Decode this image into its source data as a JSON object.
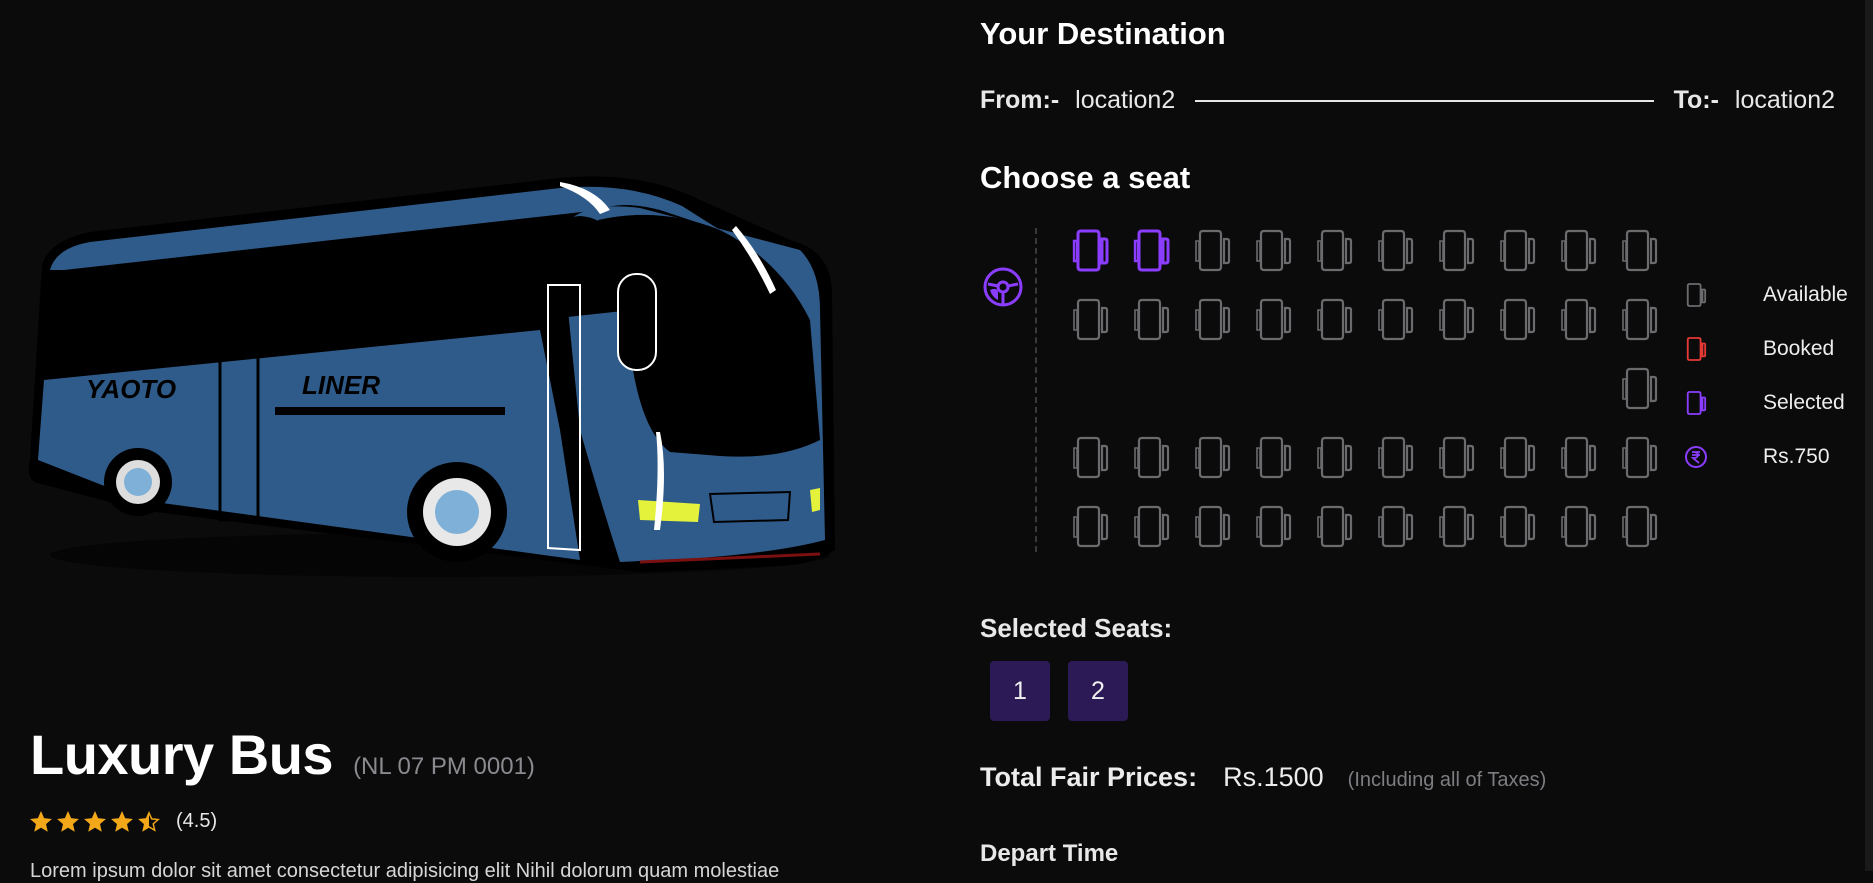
{
  "bus": {
    "name": "Luxury Bus",
    "plate": "(NL 07 PM 0001)",
    "rating_text": "(4.5)",
    "rating_value": 4.5,
    "rating_max": 5,
    "body_text_left": "YAOTO",
    "body_text_right": "LINER",
    "description_partial": "Lorem ipsum dolor sit amet consectetur adipisicing elit Nihil dolorum quam molestiae"
  },
  "destination": {
    "heading": "Your Destination",
    "from_label": "From:-",
    "from_value": "location2",
    "to_label": "To:-",
    "to_value": "location2"
  },
  "seating": {
    "heading": "Choose a seat",
    "driver_icon": "steering-wheel-icon",
    "seats": [
      {
        "id": 1,
        "status": "selected"
      },
      {
        "id": 2,
        "status": "selected"
      },
      {
        "id": 3,
        "status": "available"
      },
      {
        "id": 4,
        "status": "available"
      },
      {
        "id": 5,
        "status": "available"
      },
      {
        "id": 6,
        "status": "available"
      },
      {
        "id": 7,
        "status": "available"
      },
      {
        "id": 8,
        "status": "available"
      },
      {
        "id": 9,
        "status": "available"
      },
      {
        "id": 10,
        "status": "available"
      },
      {
        "id": 11,
        "status": "available"
      },
      {
        "id": 12,
        "status": "available"
      },
      {
        "id": 13,
        "status": "available"
      },
      {
        "id": 14,
        "status": "available"
      },
      {
        "id": 15,
        "status": "available"
      },
      {
        "id": 16,
        "status": "available"
      },
      {
        "id": 17,
        "status": "available"
      },
      {
        "id": 18,
        "status": "available"
      },
      {
        "id": 19,
        "status": "available"
      },
      {
        "id": 20,
        "status": "available"
      },
      {
        "id": 21,
        "status": "available"
      },
      {
        "id": 22,
        "status": "available"
      },
      {
        "id": 23,
        "status": "available"
      },
      {
        "id": 24,
        "status": "available"
      },
      {
        "id": 25,
        "status": "available"
      },
      {
        "id": 26,
        "status": "available"
      },
      {
        "id": 27,
        "status": "available"
      },
      {
        "id": 28,
        "status": "available"
      },
      {
        "id": 29,
        "status": "available"
      },
      {
        "id": 30,
        "status": "available"
      },
      {
        "id": 31,
        "status": "available"
      },
      {
        "id": 32,
        "status": "available"
      },
      {
        "id": 33,
        "status": "available"
      },
      {
        "id": 34,
        "status": "available"
      },
      {
        "id": 35,
        "status": "available"
      },
      {
        "id": 36,
        "status": "available"
      },
      {
        "id": 37,
        "status": "available"
      },
      {
        "id": 38,
        "status": "available"
      },
      {
        "id": 39,
        "status": "available"
      },
      {
        "id": 40,
        "status": "available"
      },
      {
        "id": 41,
        "status": "available"
      }
    ],
    "colors": {
      "available": "#6b6b6e",
      "booked": "#e53935",
      "selected": "#8b3dff"
    }
  },
  "legend": [
    {
      "icon": "seat-available-icon",
      "label": "Available",
      "color": "#6b6b6e"
    },
    {
      "icon": "seat-booked-icon",
      "label": "Booked",
      "color": "#e53935"
    },
    {
      "icon": "seat-selected-icon",
      "label": "Selected",
      "color": "#8b3dff"
    },
    {
      "icon": "rupee-icon",
      "label": "Rs.750",
      "color": "#8b3dff"
    }
  ],
  "selected": {
    "heading": "Selected Seats:",
    "seats": [
      "1",
      "2"
    ]
  },
  "pricing": {
    "label": "Total Fair Prices:",
    "total": "Rs.1500",
    "note": "(Including all of Taxes)"
  },
  "depart": {
    "heading": "Depart Time"
  }
}
